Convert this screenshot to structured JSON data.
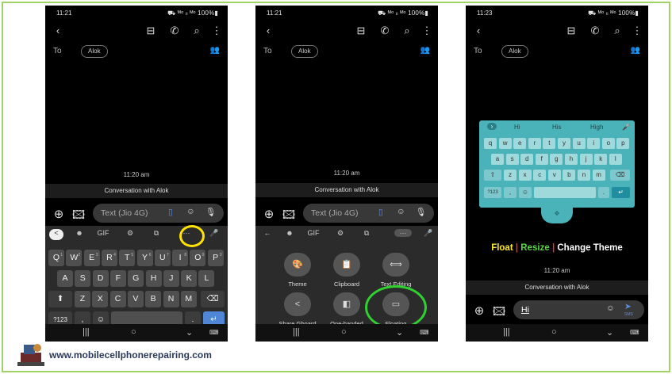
{
  "screens": [
    {
      "status_time": "11:21",
      "status_right": "⛟ ᴹᵒ ₗₗ ᴹᵒ 100%▮",
      "to_label": "To",
      "recipient": "Alok",
      "timestamp": "11:20 am",
      "conversation": "Conversation with Alok",
      "input_placeholder": "Text (Jio 4G)",
      "toolbar": [
        "<",
        "☻",
        "GIF",
        "⚙",
        "⧉",
        "···",
        "🎤"
      ],
      "rows": [
        [
          "Q",
          "W",
          "E",
          "R",
          "T",
          "Y",
          "U",
          "I",
          "O",
          "P"
        ],
        [
          "A",
          "S",
          "D",
          "F",
          "G",
          "H",
          "J",
          "K",
          "L"
        ],
        [
          "Z",
          "X",
          "C",
          "V",
          "B",
          "N",
          "M"
        ]
      ],
      "row1_sup": [
        "1",
        "2",
        "3",
        "4",
        "5",
        "6",
        "7",
        "8",
        "9",
        "0"
      ],
      "bottom_keys": [
        "?123",
        ",",
        "☺",
        ".",
        "↵"
      ]
    },
    {
      "status_time": "11:21",
      "status_right": "⛟ ᴹᵒ ₗₗ ᴹᵒ 100%▮",
      "to_label": "To",
      "recipient": "Alok",
      "timestamp": "11:20 am",
      "conversation": "Conversation with Alok",
      "input_placeholder": "Text (Jio 4G)",
      "toolbar": [
        "←",
        "☻",
        "GIF",
        "⚙",
        "⧉",
        "···",
        "🎤"
      ],
      "menu": [
        {
          "label": "Theme",
          "icon": "palette-icon",
          "glyph": "🎨"
        },
        {
          "label": "Clipboard",
          "icon": "clipboard-icon",
          "glyph": "📋"
        },
        {
          "label": "Text Editing",
          "icon": "text-editing-icon",
          "glyph": "⟺"
        },
        {
          "label": "Share Gboard",
          "icon": "share-icon",
          "glyph": "<"
        },
        {
          "label": "One-handed",
          "icon": "one-handed-icon",
          "glyph": "◧"
        },
        {
          "label": "Floating",
          "icon": "floating-icon",
          "glyph": "▭"
        }
      ]
    },
    {
      "status_time": "11:23",
      "status_right": "⛟ ᴹᵒ ₗₗ ᴹᵒ 100%▮",
      "to_label": "To",
      "recipient": "Alok",
      "timestamp": "11:20 am",
      "conversation": "Conversation with Alok",
      "input_text": "Hi",
      "send_label": "SMS",
      "suggestions": [
        "Hi",
        "His",
        "High"
      ],
      "rows": [
        [
          "q",
          "w",
          "e",
          "r",
          "t",
          "y",
          "u",
          "i",
          "o",
          "p"
        ],
        [
          "a",
          "s",
          "d",
          "f",
          "g",
          "h",
          "j",
          "k",
          "l"
        ],
        [
          "z",
          "x",
          "c",
          "v",
          "b",
          "n",
          "m"
        ]
      ],
      "bottom_keys": [
        "?123",
        ",",
        "☺",
        ".",
        "↵"
      ],
      "caption": {
        "float": "Float",
        "sep": "|",
        "resize": "Resize",
        "change": "Change Theme"
      },
      "caption_colors": {
        "float": "#ffe82a",
        "resize": "#58d640",
        "sep": "#e33",
        "change": "#ffffff"
      }
    }
  ],
  "footer": {
    "site": "www.mobilecellphonerepairing.com"
  },
  "colors": {
    "accent_blue": "#4f86d6",
    "highlight_green": "#2fd12f",
    "highlight_yellow": "#ffe200",
    "floating_keyboard": "#4ab3b9"
  }
}
